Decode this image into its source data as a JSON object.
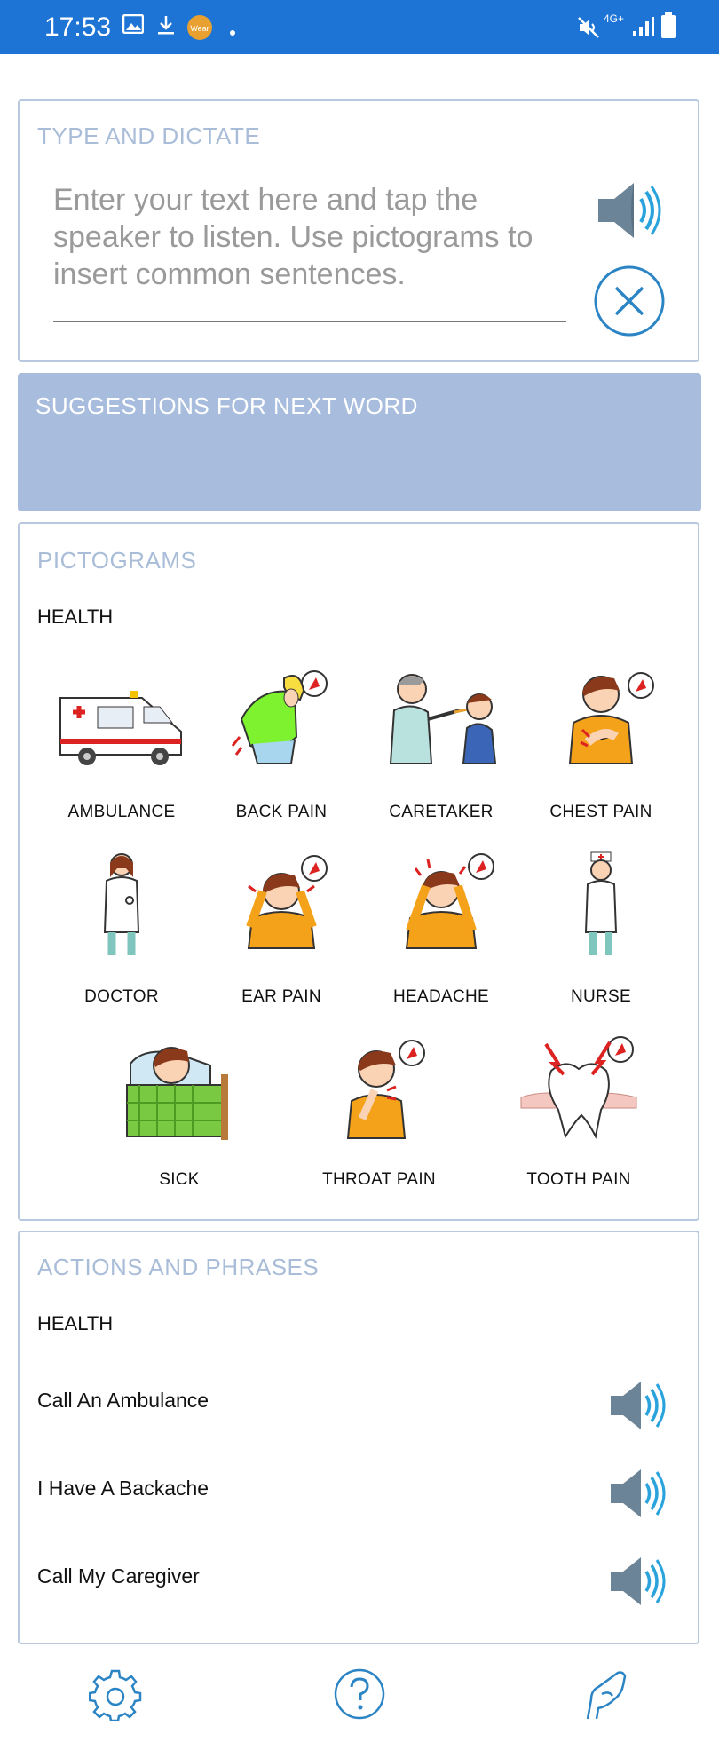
{
  "status_bar": {
    "time": "17:53",
    "network_label": "4G+",
    "wear_label": "Wear"
  },
  "type_and_dictate": {
    "title": "TYPE AND DICTATE",
    "placeholder": "Enter your text here and tap the speaker to listen. Use pictograms to insert common sentences."
  },
  "suggestions": {
    "title": "SUGGESTIONS FOR NEXT WORD"
  },
  "pictograms": {
    "title": "PICTOGRAMS",
    "category": "HEALTH",
    "items": [
      {
        "label": "AMBULANCE",
        "icon": "ambulance-icon"
      },
      {
        "label": "BACK PAIN",
        "icon": "back-pain-icon"
      },
      {
        "label": "CARETAKER",
        "icon": "caretaker-icon"
      },
      {
        "label": "CHEST PAIN",
        "icon": "chest-pain-icon"
      },
      {
        "label": "DOCTOR",
        "icon": "doctor-icon"
      },
      {
        "label": "EAR PAIN",
        "icon": "ear-pain-icon"
      },
      {
        "label": "HEADACHE",
        "icon": "headache-icon"
      },
      {
        "label": "NURSE",
        "icon": "nurse-icon"
      },
      {
        "label": "SICK",
        "icon": "sick-icon"
      },
      {
        "label": "THROAT PAIN",
        "icon": "throat-pain-icon"
      },
      {
        "label": "TOOTH PAIN",
        "icon": "tooth-pain-icon"
      }
    ]
  },
  "actions": {
    "title": "ACTIONS AND PHRASES",
    "category": "HEALTH",
    "phrases": [
      {
        "text": "Call An Ambulance"
      },
      {
        "text": "I Have A Backache"
      },
      {
        "text": "Call My Caregiver"
      }
    ]
  },
  "bottom_nav": {
    "items": [
      "gear-icon",
      "help-icon",
      "hand-icon"
    ]
  },
  "colors": {
    "status_bar": "#1d74d4",
    "section_title": "#a9bdd8",
    "suggestion_bg": "#a8bddd",
    "accent": "#2b84c4"
  }
}
